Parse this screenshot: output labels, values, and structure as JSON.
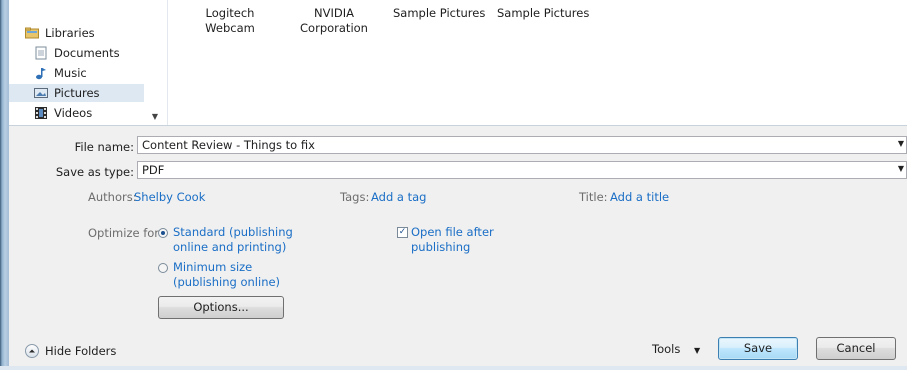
{
  "nav": {
    "libraries": "Libraries",
    "items": [
      {
        "label": "Documents",
        "icon": "document-icon"
      },
      {
        "label": "Music",
        "icon": "music-note-icon"
      },
      {
        "label": "Pictures",
        "icon": "pictures-icon",
        "selected": true
      },
      {
        "label": "Videos",
        "icon": "film-icon"
      }
    ]
  },
  "files": [
    {
      "line1": "Logitech",
      "line2": "Webcam"
    },
    {
      "line1": "NVIDIA",
      "line2": "Corporation"
    },
    {
      "line1": "Sample Pictures",
      "line2": ""
    },
    {
      "line1": "Sample Pictures",
      "line2": ""
    }
  ],
  "form": {
    "file_name_label": "File name:",
    "file_name_value": "Content Review - Things to fix",
    "save_type_label": "Save as type:",
    "save_type_value": "PDF",
    "authors_label": "Authors:",
    "authors_value": "Shelby Cook",
    "tags_label": "Tags:",
    "tags_value": "Add a tag",
    "title_label": "Title:",
    "title_value": "Add a title",
    "optimize_label": "Optimize for:",
    "opt_standard_1": "Standard (publishing",
    "opt_standard_2": "online and printing)",
    "opt_minimum_1": "Minimum size",
    "opt_minimum_2": "(publishing online)",
    "open_after_1": "Open file after",
    "open_after_2": "publishing",
    "options_button": "Options..."
  },
  "footer": {
    "hide_folders": "Hide Folders",
    "tools": "Tools",
    "save": "Save",
    "cancel": "Cancel"
  },
  "colors": {
    "link": "#1a6ec6",
    "form_bg": "#f0f0f0",
    "selection": "#dde8f3"
  }
}
